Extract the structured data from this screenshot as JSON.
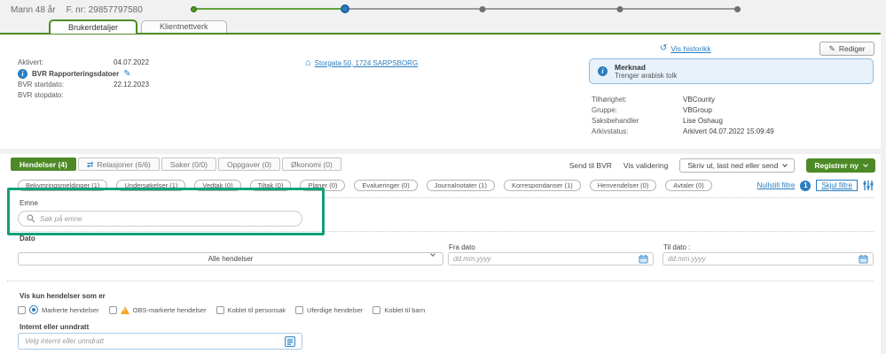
{
  "header": {
    "person": "Mann 48 år",
    "fnr": "F. nr: 29857797580"
  },
  "tabs": [
    {
      "label": "Brukerdetaljer"
    },
    {
      "label": "Klientnettverk"
    }
  ],
  "icons": {
    "house": "⌂",
    "history": "↺",
    "pencil": "✎",
    "relations": "⇄",
    "info": "i"
  },
  "user_details": {
    "left": [
      {
        "label": "Aktivert:",
        "value": "04.07.2022"
      },
      {
        "label": "BVR startdato:",
        "value": "22.12.2023"
      },
      {
        "label": "BVR stopdato:",
        "value": ""
      }
    ],
    "bvr_link": "BVR Rapporteringsdatoer",
    "address": "Storgata 50, 1724 SARPSBORG",
    "right": [
      {
        "label": "Tilhørighet:",
        "value": "VBCounty"
      },
      {
        "label": "Gruppe:",
        "value": "VBGroup"
      },
      {
        "label": "Saksbehandler",
        "value": "Lise Oshaug"
      },
      {
        "label": "Arkivstatus:",
        "value": "Arkivert 04.07.2022 15:09:49"
      }
    ]
  },
  "actions": {
    "vis_historikk": "Vis historikk",
    "rediger": "Rediger"
  },
  "merknad": {
    "title": "Merknad",
    "text": "Trenger arabisk tolk"
  },
  "section_tabs": [
    "Hendelser (4)",
    "Relasjoner (6/6)",
    "Saker (0/0)",
    "Oppgaver (0)",
    "Økonomi (0)"
  ],
  "toolbar": {
    "send": "Send til BVR",
    "validate": "Vis validering",
    "print": "Skriv ut, last ned eller send",
    "register": "Registrer ny"
  },
  "filter_pills": [
    "Bekymringsmeldinger (1)",
    "Undersøkelser (1)",
    "Vedtak (0)",
    "Tiltak (0)",
    "Planer (0)",
    "Evalueringer (0)",
    "Journalnotater (1)",
    "Korrespondanser (1)",
    "Henvendelser (0)",
    "Avtaler (0)"
  ],
  "filter_controls": {
    "nullstill": "Nullstill filtre",
    "badge": "1",
    "skjul": "Skjul filtre"
  },
  "search": {
    "label": "Emne",
    "placeholder": "Søk på emne"
  },
  "date_filter": {
    "label": "Dato",
    "select_value": "Alle hendelser",
    "from_label": "Fra dato",
    "to_label": "Til dato :",
    "placeholder": "dd.mm.yyyy"
  },
  "event_filters": {
    "label": "Vis kun hendelser som er",
    "options": [
      "Markerte hendelser",
      "OBS-markerte hendelser",
      "Koblet til personsak",
      "Uferdige hendelser",
      "Koblet til barn"
    ]
  },
  "internal_filter": {
    "label": "Internt eller unndratt",
    "placeholder": "Velg internt eller unndratt"
  },
  "colors": {
    "green": "#4d8a27",
    "blue": "#2b7dc0",
    "highlight": "#10a07a",
    "warning": "#f5a623"
  }
}
